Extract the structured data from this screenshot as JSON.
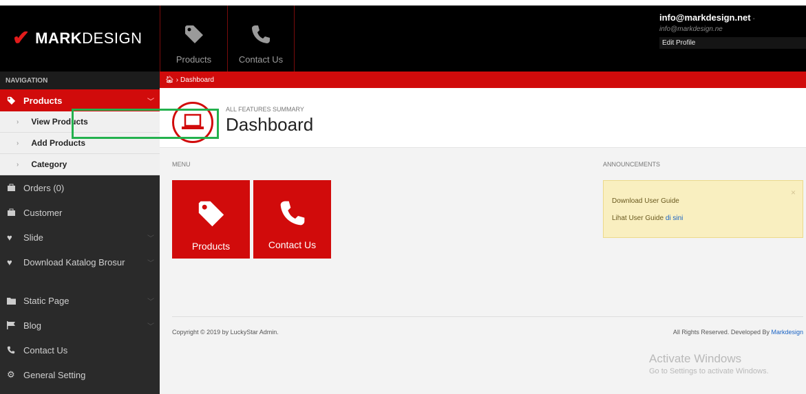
{
  "brand": {
    "mark": "✔",
    "bold": "MARK",
    "rest": "DESIGN"
  },
  "topnav": [
    {
      "label": "Products",
      "icon": "tag-icon"
    },
    {
      "label": "Contact Us",
      "icon": "phone-icon"
    }
  ],
  "user": {
    "email": "info@markdesign.net",
    "email_sub": " - info@markdesign.ne",
    "edit_label": "Edit Profile"
  },
  "sidebar": {
    "heading": "NAVIGATION",
    "active": {
      "label": "Products"
    },
    "subitems": [
      "View Products",
      "Add Products",
      "Category"
    ],
    "items": [
      {
        "label": "Orders (0)"
      },
      {
        "label": "Customer"
      },
      {
        "label": "Slide"
      },
      {
        "label": "Download Katalog Brosur"
      },
      {
        "label": "Static Page"
      },
      {
        "label": "Blog"
      },
      {
        "label": "Contact Us"
      },
      {
        "label": "General Setting"
      }
    ]
  },
  "breadcrumb": {
    "label": "Dashboard"
  },
  "header": {
    "summary": "ALL FEATURES SUMMARY",
    "title": "Dashboard"
  },
  "menu": {
    "label": "MENU",
    "tiles": [
      "Products",
      "Contact Us"
    ]
  },
  "announcements": {
    "label": "ANNOUNCEMENTS",
    "close": "×",
    "line1": "Download User Guide",
    "line2_prefix": "Lihat User Guide ",
    "line2_link": "di sini"
  },
  "footer": {
    "copyright": "Copyright © 2019 by LuckyStar Admin.",
    "rights_prefix": "All Rights Reserved. Developed By ",
    "rights_link": "Markdesign"
  },
  "watermark": {
    "title": "Activate Windows",
    "sub": "Go to Settings to activate Windows."
  },
  "colors": {
    "accent": "#d10b0b",
    "sidebar": "#2a2a2a",
    "highlight": "#23b14d"
  }
}
